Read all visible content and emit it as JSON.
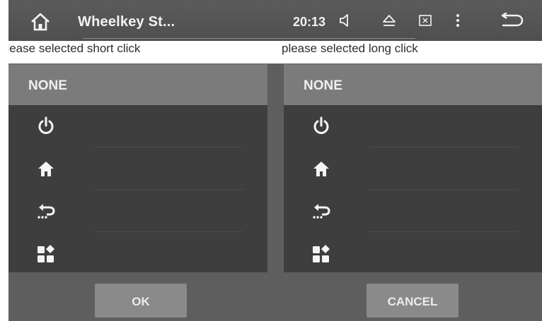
{
  "status_bar": {
    "title": "Wheelkey St...",
    "time": "20:13",
    "icons": [
      "home-icon",
      "volume-icon",
      "eject-icon",
      "screen-off-icon",
      "more-vertical-icon",
      "back-icon"
    ]
  },
  "short_click": {
    "caption": "please selected short click",
    "selected": "NONE",
    "options": [
      "power-icon",
      "home-icon",
      "back-icon",
      "apps-icon"
    ]
  },
  "long_click": {
    "caption": "please selected long click",
    "selected": "NONE",
    "options": [
      "power-icon",
      "home-icon",
      "back-icon",
      "apps-icon"
    ]
  },
  "buttons": {
    "ok_label": "OK",
    "cancel_label": "CANCEL"
  },
  "colors": {
    "screen_bg": "#5e5e5e",
    "list_bg": "#3e3e3e",
    "selected_row": "#7b7b7b",
    "button_bg": "#8a8a8a",
    "text": "#f0f0f0"
  }
}
